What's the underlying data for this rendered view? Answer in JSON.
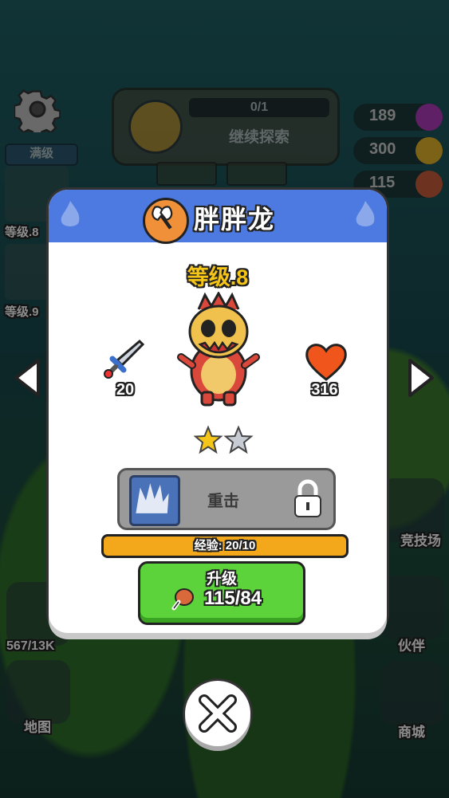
{
  "hud": {
    "max_level_label": "满级",
    "side_levels": [
      "等级.8",
      "等级.9"
    ],
    "explore_progress": "0/1",
    "explore_label": "继续探索",
    "gems": "189",
    "coins": "300",
    "meat": "115"
  },
  "right_menu": {
    "arena": "竞技场",
    "partner": "伙伴",
    "shop": "商城"
  },
  "left_menu": {
    "counter": "567/13K",
    "map": "地图"
  },
  "pet": {
    "name": "胖胖龙",
    "level": "等级.8",
    "attack": "20",
    "hp": "316",
    "stars_filled": 1,
    "stars_total": 2,
    "skill_name": "重击",
    "xp_text": "经验: 20/10",
    "upgrade_label": "升级",
    "upgrade_cost": "115/84"
  },
  "colors": {
    "header_blue": "#4d7ae0",
    "level_gold": "#f5c518",
    "upgrade_green": "#5cd33b",
    "xp_orange": "#f3a81c"
  }
}
